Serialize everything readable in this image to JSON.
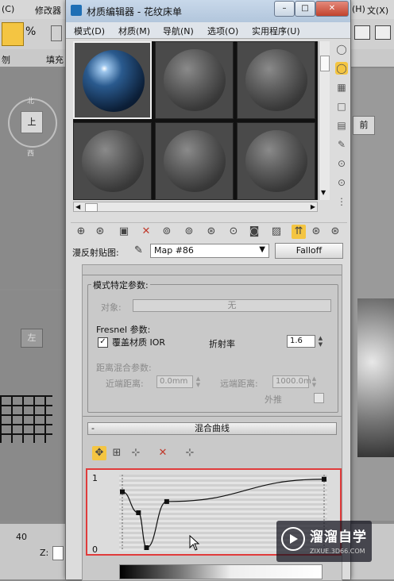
{
  "background": {
    "menu_items": [
      "(C)",
      "修改器",
      "(H)",
      "文(X)"
    ],
    "ribbon_left": "刎",
    "ribbon_mid": "填充",
    "ribbon_right": "前",
    "view_label_top": "上",
    "view_label_left": "左",
    "view_compass_n": "北",
    "view_compass_s": "西",
    "status_value": "40",
    "status_z": "Z:"
  },
  "window": {
    "title": "材质编辑器 - 花纹床单",
    "icon": "max-material-editor-icon",
    "controls": [
      "minimize",
      "maximize",
      "close"
    ]
  },
  "menu": [
    "模式(D)",
    "材质(M)",
    "导航(N)",
    "选项(O)",
    "实用程序(U)"
  ],
  "sample_slots": [
    {
      "type": "glass",
      "active": true
    },
    {
      "type": "matte",
      "active": false
    },
    {
      "type": "matte",
      "active": false
    },
    {
      "type": "matte",
      "active": false
    },
    {
      "type": "matte",
      "active": false
    },
    {
      "type": "matte",
      "active": false
    }
  ],
  "map_row": {
    "label": "漫反射贴图:",
    "map_name": "Map #86",
    "map_type": "Falloff"
  },
  "mode_params": {
    "header": "模式特定参数:",
    "object_label": "对象:",
    "object_button": "无",
    "fresnel_header": "Fresnel 参数:",
    "override_label": "覆盖材质 IOR",
    "override_checked": true,
    "ior_label": "折射率",
    "ior_value": "1.6",
    "distance_header": "距离混合参数:",
    "near_label": "近端距离:",
    "near_value": "0.0mm",
    "far_label": "远端距离:",
    "far_value": "1000.0m",
    "extrapolate_label": "外推",
    "extrapolate_checked": false
  },
  "mix_curve": {
    "collapse": "-",
    "header": "混合曲线",
    "y_top": "1",
    "y_bottom": "0",
    "points": [
      [
        0.0,
        0.8
      ],
      [
        0.08,
        0.5
      ],
      [
        0.12,
        0.0
      ],
      [
        0.22,
        0.66
      ],
      [
        1.0,
        0.98
      ]
    ]
  },
  "watermark": {
    "title": "溜溜自学",
    "url": "ZIXUE.3D66.COM"
  }
}
